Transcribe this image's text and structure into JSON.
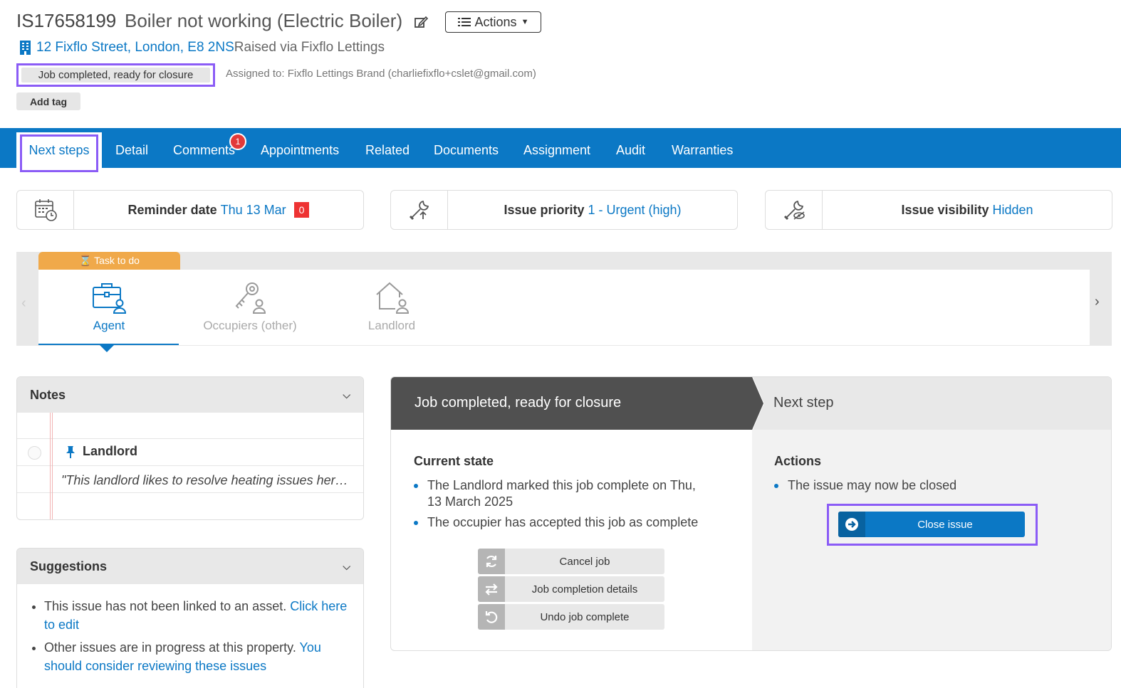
{
  "header": {
    "issue_id": "IS17658199",
    "issue_title": "Boiler not working (Electric Boiler)",
    "actions_label": "Actions",
    "address": "12 Fixflo Street, London, E8 2NS",
    "raised_via": "Raised via Fixflo Lettings",
    "status": "Job completed, ready for closure",
    "assigned_to": "Assigned to: Fixflo Lettings Brand (charliefixflo+cslet@gmail.com)",
    "add_tag": "Add tag"
  },
  "tabs": [
    {
      "label": "Next steps"
    },
    {
      "label": "Detail"
    },
    {
      "label": "Comments",
      "badge": "1"
    },
    {
      "label": "Appointments"
    },
    {
      "label": "Related"
    },
    {
      "label": "Documents"
    },
    {
      "label": "Assignment"
    },
    {
      "label": "Audit"
    },
    {
      "label": "Warranties"
    }
  ],
  "cards": {
    "reminder": {
      "label": "Reminder date",
      "value": "Thu 13 Mar",
      "count": "0"
    },
    "priority": {
      "label": "Issue priority",
      "value": "1 - Urgent (high)"
    },
    "visibility": {
      "label": "Issue visibility",
      "value": "Hidden"
    }
  },
  "stepper": {
    "task_label": "Task to do",
    "steps": [
      {
        "label": "Agent",
        "icon": "briefcase-user-icon"
      },
      {
        "label": "Occupiers (other)",
        "icon": "key-user-icon"
      },
      {
        "label": "Landlord",
        "icon": "house-user-icon"
      }
    ]
  },
  "notes": {
    "title": "Notes",
    "entry_title": "Landlord",
    "entry_text": "\"This landlord likes to resolve heating issues her…"
  },
  "suggestions": {
    "title": "Suggestions",
    "items": [
      {
        "text": "This issue has not been linked to an asset. ",
        "link": "Click here to edit"
      },
      {
        "text": "Other issues are in progress at this property. ",
        "link": "You should consider reviewing these issues"
      }
    ]
  },
  "status_panel": {
    "left_header": "Job completed, ready for closure",
    "right_header": "Next step",
    "current_state_title": "Current state",
    "current_state": [
      "The Landlord marked this job complete on Thu, 13 March 2025",
      "The occupier has accepted this job as complete"
    ],
    "buttons": [
      {
        "label": "Cancel job",
        "icon": "refresh-icon"
      },
      {
        "label": "Job completion details",
        "icon": "exchange-icon"
      },
      {
        "label": "Undo job complete",
        "icon": "undo-icon"
      }
    ],
    "actions_title": "Actions",
    "actions": [
      "The issue may now be closed"
    ],
    "close_label": "Close issue"
  },
  "colors": {
    "brand_blue": "#0b78c5",
    "highlight_purple": "#8b5cf6",
    "task_orange": "#f0a94a",
    "alert_red": "#e33333"
  }
}
